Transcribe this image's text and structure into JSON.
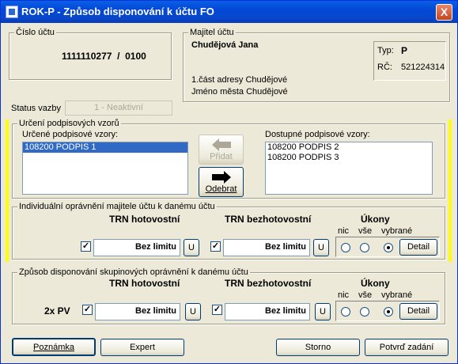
{
  "window": {
    "title": "ROK-P - Způsob disponování k účtu  FO",
    "close_glyph": "X"
  },
  "cislo_uctu": {
    "label": "Číslo účtu",
    "value": "1111110277  /  0100"
  },
  "majitel": {
    "label": "Majitel účtu",
    "name": "Chudějová Jana",
    "typ_label": "Typ:",
    "typ_value": "P",
    "rc_label": "RČ:",
    "rc_value": "521224314",
    "address_line1": "1.část adresy Chudějové",
    "address_line2": "Jméno města Chudějové"
  },
  "status_vazby": {
    "label": "Status vazby",
    "value": "1 - Neaktivní"
  },
  "urceni": {
    "label": "Určení podpisových vzorů",
    "assigned_label": "Určené podpisové vzory:",
    "assigned_items": [
      "108200 PODPIS 1"
    ],
    "available_label": "Dostupné podpisové vzory:",
    "available_items": [
      "108200 PODPIS 2",
      "108200 PODPIS 3"
    ],
    "add_label": "Přidat",
    "remove_label": "Odebrat"
  },
  "individualni": {
    "label": "Individuální oprávnění majitele účtu k danému účtu",
    "trn_hot_label": "TRN hotovostní",
    "trn_bez_label": "TRN bezhotovostní",
    "ukony_label": "Úkony",
    "nic_label": "nic",
    "vse_label": "vše",
    "vybrane_label": "vybrané",
    "hot_value": "Bez limitu",
    "bez_value": "Bez limitu",
    "u_label": "U",
    "detail_label": "Detail"
  },
  "skupinove": {
    "label": "Způsob disponování skupinových oprávnění k danému účtu",
    "trn_hot_label": "TRN hotovostní",
    "trn_bez_label": "TRN bezhotovostní",
    "ukony_label": "Úkony",
    "nic_label": "nic",
    "vse_label": "vše",
    "vybrane_label": "vybrané",
    "row_label": "2x PV",
    "hot_value": "Bez limitu",
    "bez_value": "Bez limitu",
    "u_label": "U",
    "detail_label": "Detail"
  },
  "footer": {
    "poznamka_label": "Poznámka",
    "expert_label": "Expert",
    "storno_label": "Storno",
    "potvrd_label": "Potvrď zadání"
  },
  "colors": {
    "title_bar": "#0a5fe6",
    "selection": "#316ac5",
    "highlight_bar": "#ffff00"
  }
}
